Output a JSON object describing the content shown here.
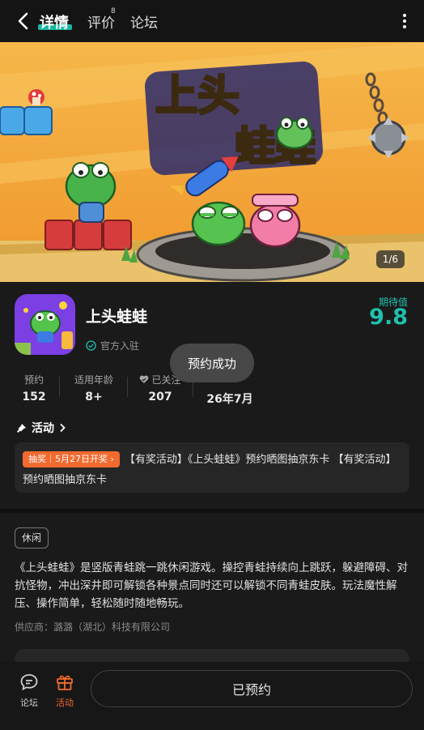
{
  "header": {
    "tabs": [
      {
        "label": "详情",
        "active": true
      },
      {
        "label": "评价",
        "count": "8"
      },
      {
        "label": "论坛"
      }
    ]
  },
  "banner": {
    "logo_line1": "上头",
    "logo_line2": "蛙蛙",
    "pager": "1/6"
  },
  "app": {
    "name": "上头蛙蛙",
    "official": "官方入驻",
    "expect_label": "期待值",
    "expect_value": "9.8"
  },
  "stats": [
    {
      "label": "预约",
      "value": "152"
    },
    {
      "label": "适用年龄",
      "value": "8+"
    },
    {
      "label": "已关注",
      "value": "207"
    },
    {
      "label": "",
      "value": "26年7月"
    }
  ],
  "toast": "预约成功",
  "activity": {
    "title": "活动",
    "badge": "抽奖｜5月27日开奖 ›",
    "text": "【有奖活动】《上头蛙蛙》预约晒图抽京东卡 【有奖活动】预约晒图抽京东卡"
  },
  "tag": "休闲",
  "description": "《上头蛙蛙》是竖版青蛙跳一跳休闲游戏。操控青蛙持续向上跳跃，躲避障碍、对抗怪物，冲出深井即可解锁各种景点同时还可以解锁不同青蛙皮肤。玩法魔性解压、操作简单，轻松随时随地畅玩。",
  "supplier": "供应商：潞潞（湖北）科技有限公司",
  "bottom": {
    "forum_label": "论坛",
    "activity_label": "活动",
    "reserve_label": "已预约"
  },
  "colors": {
    "accent": "#1fc1ad",
    "orange": "#f26a2f",
    "background": "#1a1a1a"
  }
}
